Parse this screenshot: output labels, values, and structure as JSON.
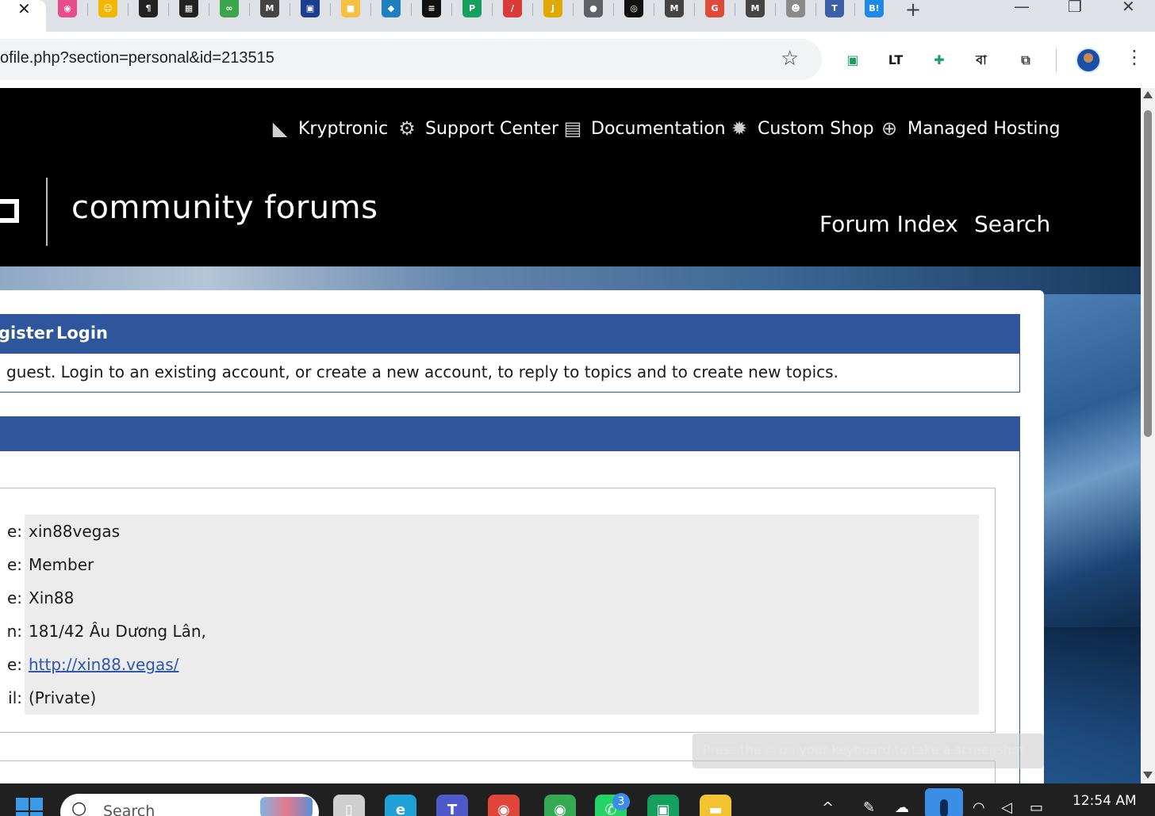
{
  "browser": {
    "active_tab_close": "✕",
    "new_tab": "+",
    "window_controls": {
      "minimize": "—",
      "restore": "❐",
      "close": "✕"
    },
    "tab_favicons": [
      {
        "icon": "color-wheel-icon",
        "glyph": "◉",
        "color": "#e84c8a"
      },
      {
        "icon": "emoji-icon",
        "glyph": "☺",
        "color": "#f2b705"
      },
      {
        "icon": "pilcrow-icon",
        "glyph": "¶",
        "color": "#222222"
      },
      {
        "icon": "grid-logo-icon",
        "glyph": "▦",
        "color": "#222222"
      },
      {
        "icon": "link-icon",
        "glyph": "∞",
        "color": "#3aa54a"
      },
      {
        "icon": "m-logo-icon",
        "glyph": "M",
        "color": "#444444"
      },
      {
        "icon": "save-icon",
        "glyph": "▣",
        "color": "#1e3d8f"
      },
      {
        "icon": "note-icon",
        "glyph": "■",
        "color": "#f6c142"
      },
      {
        "icon": "diamond-icon",
        "glyph": "◆",
        "color": "#1f7fbf"
      },
      {
        "icon": "stripes-icon",
        "glyph": "≡",
        "color": "#111111"
      },
      {
        "icon": "p-logo-icon",
        "glyph": "P",
        "color": "#16a05d"
      },
      {
        "icon": "slash-icon",
        "glyph": "/",
        "color": "#d93b3b"
      },
      {
        "icon": "jobs-icon",
        "glyph": "J",
        "color": "#e0a800"
      },
      {
        "icon": "globe-icon",
        "glyph": "●",
        "color": "#5f6368"
      },
      {
        "icon": "github-icon",
        "glyph": "◎",
        "color": "#111111"
      },
      {
        "icon": "m-logo-icon",
        "glyph": "M",
        "color": "#444444"
      },
      {
        "icon": "gc-logo-icon",
        "glyph": "G",
        "color": "#e04a3a"
      },
      {
        "icon": "m-logo-icon",
        "glyph": "M",
        "color": "#444444"
      },
      {
        "icon": "cartoon-icon",
        "glyph": "☻",
        "color": "#8a8a8a"
      },
      {
        "icon": "tot-logo-icon",
        "glyph": "T",
        "color": "#3c5fa8"
      },
      {
        "icon": "b-logo-icon",
        "glyph": "B!",
        "color": "#1e88e5"
      }
    ]
  },
  "toolbar": {
    "url": "ofile.php?section=personal&id=213515",
    "star": "☆",
    "extensions": [
      {
        "icon": "cassette-icon",
        "glyph": "▣",
        "color": "#16a05d"
      },
      {
        "icon": "languagetool-icon",
        "glyph": "LT",
        "color": "#1a1a1a"
      },
      {
        "icon": "add-puzzle-icon",
        "glyph": "✚",
        "color": "#16a05d"
      },
      {
        "icon": "bengali-letter-icon",
        "glyph": "বা",
        "color": "#1a1a1a"
      },
      {
        "icon": "puzzle-icon",
        "glyph": "⧉",
        "color": "#3c4043"
      }
    ],
    "menu": "⋮"
  },
  "header": {
    "top_nav": [
      {
        "label": "Kryptronic",
        "icon": "kryptronic-logo-icon",
        "glyph": "◣"
      },
      {
        "label": "Support Center",
        "icon": "support-gear-icon",
        "glyph": "⚙"
      },
      {
        "label": "Documentation",
        "icon": "document-icon",
        "glyph": "▤"
      },
      {
        "label": "Custom Shop",
        "icon": "cog-icon",
        "glyph": "✹"
      },
      {
        "label": "Managed Hosting",
        "icon": "globe-icon",
        "glyph": "⊕"
      }
    ],
    "brand": "community forums",
    "main_nav": [
      {
        "label": "Forum Index"
      },
      {
        "label": "Search"
      }
    ]
  },
  "menu_bar": {
    "register": "gister",
    "login": "Login"
  },
  "notice": " guest. Login to an existing account, or create a new account, to reply to topics and to create new topics.",
  "profile": {
    "rows": [
      {
        "label": "e:",
        "value": "xin88vegas",
        "is_link": false
      },
      {
        "label": "e:",
        "value": "Member",
        "is_link": false
      },
      {
        "label": "e:",
        "value": "Xin88",
        "is_link": false
      },
      {
        "label": "n:",
        "value": "181/42 Âu Dương Lân,",
        "is_link": false
      },
      {
        "label": "e:",
        "value": "http://xin88.vegas/",
        "is_link": true
      },
      {
        "label": "il:",
        "value": "(Private)",
        "is_link": false
      }
    ]
  },
  "toast": "Press the ⎙ on your keyboard to take a screenshot",
  "taskbar": {
    "search_placeholder": "Search",
    "search_glyph": "○",
    "apps": [
      {
        "icon": "file-icon",
        "glyph": "▯",
        "color": "#cfcfcf"
      },
      {
        "icon": "edge-icon",
        "glyph": "e",
        "color": "#1fa1d8"
      },
      {
        "icon": "teams-icon",
        "glyph": "T",
        "color": "#5059c9"
      },
      {
        "icon": "chrome-profile-icon",
        "glyph": "◉",
        "color": "#e0453a"
      },
      {
        "icon": "chrome-icon",
        "glyph": "◉",
        "color": "#34a853"
      },
      {
        "icon": "whatsapp-icon",
        "glyph": "✆",
        "color": "#25d366"
      },
      {
        "icon": "cassette-icon",
        "glyph": "▣",
        "color": "#16a05d"
      },
      {
        "icon": "folder-icon",
        "glyph": "▬",
        "color": "#f4c430"
      }
    ],
    "whatsapp_badge": "3",
    "tray_chevron": "^",
    "tray_icons": [
      {
        "icon": "pen-icon",
        "glyph": "✎"
      },
      {
        "icon": "cloud-icon",
        "glyph": "☁"
      },
      {
        "icon": "wifi-icon",
        "glyph": "◠"
      },
      {
        "icon": "volume-icon",
        "glyph": "◁"
      },
      {
        "icon": "battery-icon",
        "glyph": "▭"
      }
    ],
    "clock": "12:54 AM"
  }
}
